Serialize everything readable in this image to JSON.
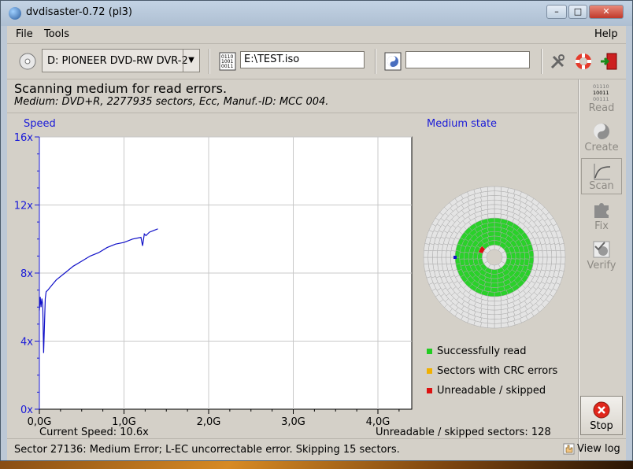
{
  "window": {
    "title": "dvdisaster-0.72 (pl3)"
  },
  "menu": {
    "file": "File",
    "tools": "Tools",
    "help": "Help"
  },
  "toolbar": {
    "drive": "D: PIONEER DVD-RW DVR-2",
    "image_file": "E:\\TEST.iso",
    "ecc_file": ""
  },
  "header": {
    "message": "Scanning medium for read errors.",
    "medium_info": "Medium: DVD+R, 2277935 sectors, Ecc, Manuf.-ID: MCC     004."
  },
  "speed_panel": {
    "title": "Speed",
    "current_speed": "Current Speed: 10.6x"
  },
  "medium_panel": {
    "title": "Medium state",
    "unreadable_count": "Unreadable / skipped sectors: 128",
    "legend": [
      {
        "label": "Successfully read",
        "color": "#22cc22"
      },
      {
        "label": "Sectors with CRC errors",
        "color": "#f0b000"
      },
      {
        "label": "Unreadable / skipped",
        "color": "#dd1111"
      }
    ],
    "colors": {
      "unread": "#e4e4e4",
      "read": "#2ad12a",
      "error": "#dd1111",
      "cursor": "#1111cc"
    }
  },
  "sidebar": {
    "read": "Read",
    "create": "Create",
    "scan": "Scan",
    "fix": "Fix",
    "verify": "Verify",
    "stop": "Stop"
  },
  "status": {
    "text": "Sector 27136: Medium Error; L-EC uncorrectable error. Skipping 15 sectors.",
    "view_log": "View log"
  },
  "chart_data": {
    "type": "line",
    "title": "Speed",
    "xlabel": "",
    "ylabel": "",
    "x_ticks": [
      "0,0G",
      "1,0G",
      "2,0G",
      "3,0G",
      "4,0G"
    ],
    "y_ticks": [
      "0x",
      "4x",
      "8x",
      "12x",
      "16x"
    ],
    "xlim": [
      0,
      4.4
    ],
    "ylim": [
      0,
      16
    ],
    "grid": true,
    "color": "#1010c8",
    "series": [
      {
        "x": [
          0.0,
          0.01,
          0.02,
          0.03,
          0.04,
          0.05,
          0.06,
          0.07,
          0.08,
          0.1,
          0.15,
          0.2,
          0.3,
          0.4,
          0.5,
          0.6,
          0.7,
          0.8,
          0.9,
          1.0,
          1.1,
          1.2,
          1.22,
          1.24,
          1.26,
          1.3,
          1.35,
          1.4
        ],
        "y": [
          5.8,
          6.6,
          6.0,
          6.5,
          6.1,
          3.3,
          5.0,
          6.5,
          6.9,
          7.0,
          7.3,
          7.6,
          8.0,
          8.4,
          8.7,
          9.0,
          9.2,
          9.5,
          9.7,
          9.8,
          10.0,
          10.1,
          9.6,
          10.3,
          10.2,
          10.4,
          10.5,
          10.6
        ]
      }
    ]
  }
}
